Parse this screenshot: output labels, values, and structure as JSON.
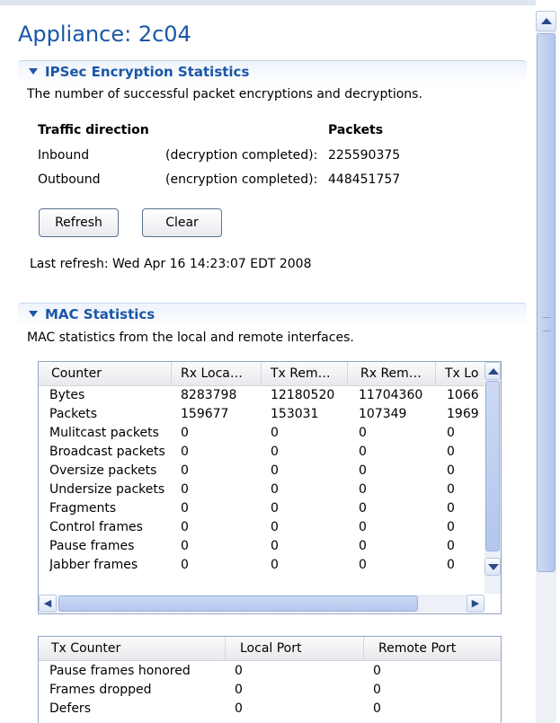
{
  "page": {
    "title": "Appliance: 2c04"
  },
  "ipsec": {
    "title": "IPSec Encryption Statistics",
    "description": "The number of successful packet encryptions and decryptions.",
    "header_direction": "Traffic direction",
    "header_packets": "Packets",
    "rows": [
      {
        "direction": "Inbound",
        "detail": "(decryption completed):",
        "packets": "225590375"
      },
      {
        "direction": "Outbound",
        "detail": "(encryption completed):",
        "packets": "448451757"
      }
    ],
    "refresh_label": "Refresh",
    "clear_label": "Clear",
    "last_refresh": "Last refresh: Wed Apr 16 14:23:07 EDT 2008"
  },
  "mac": {
    "title": "MAC Statistics",
    "description": "MAC statistics from the local and remote interfaces.",
    "columns": [
      "Counter",
      "Rx Loca…",
      "Tx Rem…",
      "Rx Rem…",
      "Tx Lo"
    ],
    "rows": [
      [
        "Bytes",
        "8283798",
        "12180520",
        "11704360",
        "1066"
      ],
      [
        "Packets",
        "159677",
        "153031",
        "107349",
        "1969"
      ],
      [
        "Mulitcast packets",
        "0",
        "0",
        "0",
        "0"
      ],
      [
        "Broadcast packets",
        "0",
        "0",
        "0",
        "0"
      ],
      [
        "Oversize packets",
        "0",
        "0",
        "0",
        "0"
      ],
      [
        "Undersize packets",
        "0",
        "0",
        "0",
        "0"
      ],
      [
        "Fragments",
        "0",
        "0",
        "0",
        "0"
      ],
      [
        "Control frames",
        "0",
        "0",
        "0",
        "0"
      ],
      [
        "Pause frames",
        "0",
        "0",
        "0",
        "0"
      ],
      [
        "Jabber frames",
        "0",
        "0",
        "0",
        "0"
      ]
    ]
  },
  "tx": {
    "columns": [
      "Tx Counter",
      "Local Port",
      "Remote Port"
    ],
    "rows": [
      [
        "Pause frames honored",
        "0",
        "0"
      ],
      [
        "Frames dropped",
        "0",
        "0"
      ],
      [
        "Defers",
        "0",
        "0"
      ]
    ]
  },
  "colors": {
    "accent": "#1a57a8",
    "border": "#8fa3c3",
    "scrollbar": "#b3c6ee"
  }
}
